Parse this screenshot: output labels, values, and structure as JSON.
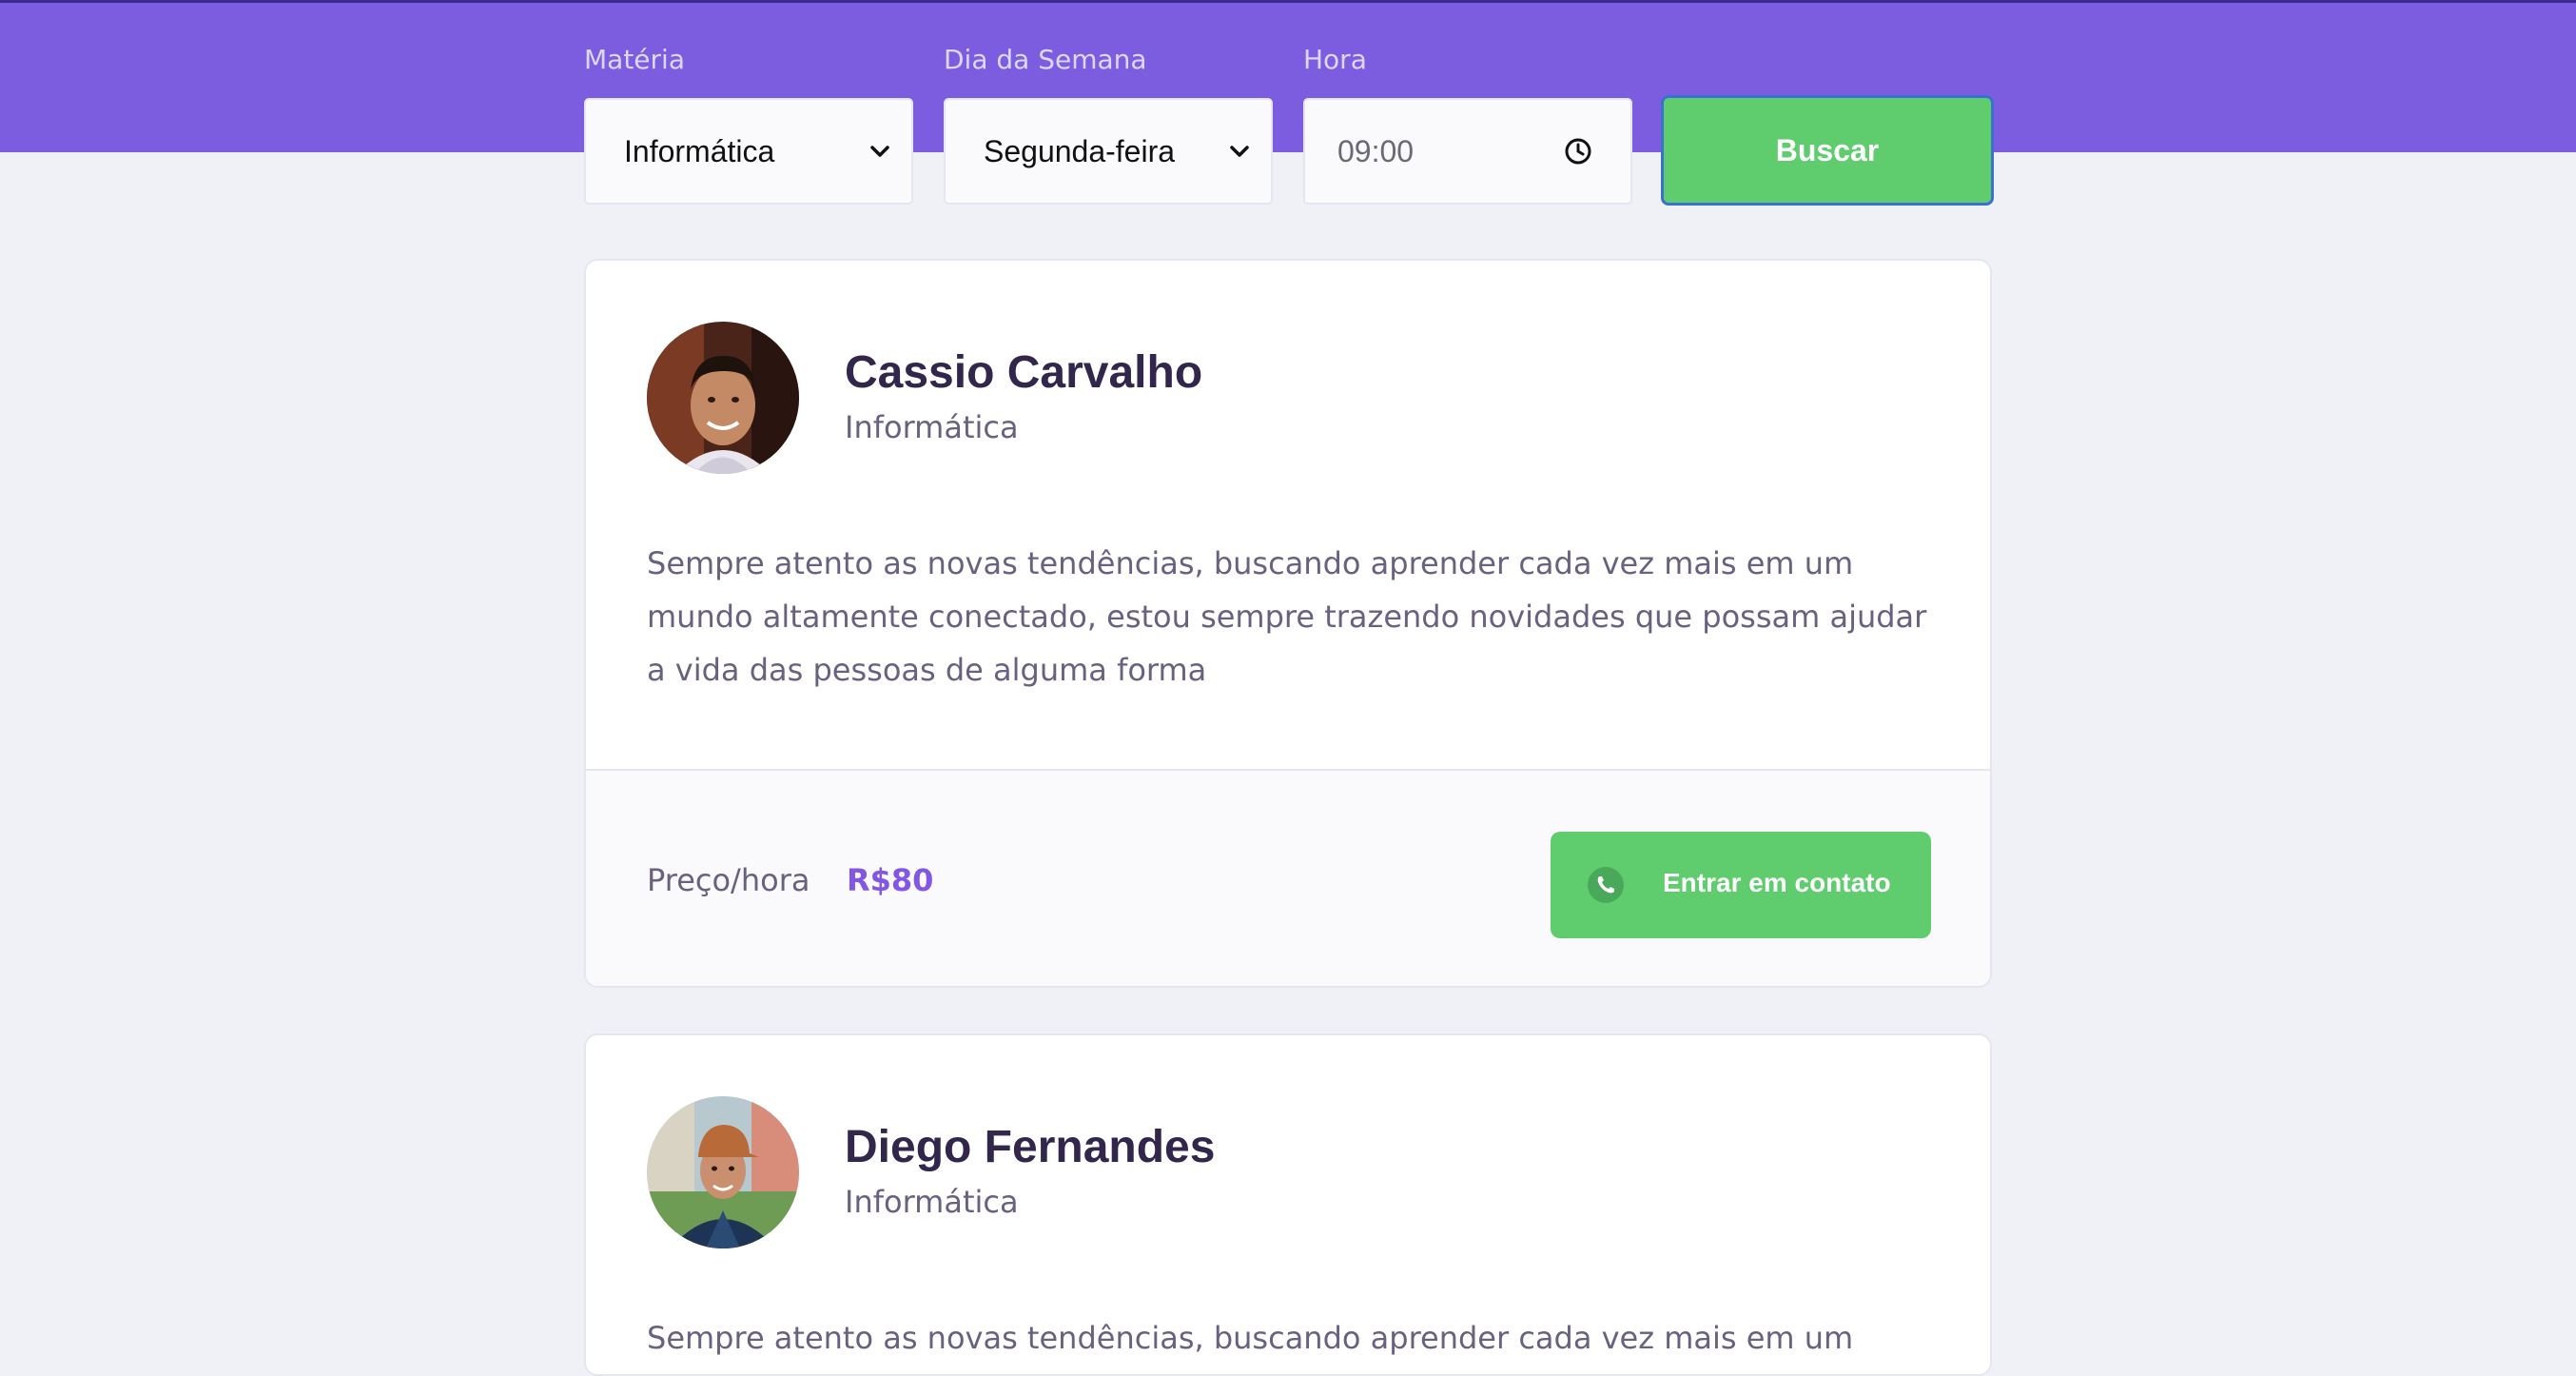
{
  "filters": {
    "subject": {
      "label": "Matéria",
      "value": "Informática"
    },
    "weekday": {
      "label": "Dia da Semana",
      "value": "Segunda-feira"
    },
    "time": {
      "label": "Hora",
      "value": "09:00"
    },
    "search_label": "Buscar"
  },
  "teachers": [
    {
      "name": "Cassio Carvalho",
      "subject": "Informática",
      "bio": "Sempre atento as novas tendências, buscando aprender cada vez mais em um mundo altamente conectado, estou sempre trazendo novidades que possam ajudar a vida das pessoas de alguma forma",
      "price_label": "Preço/hora",
      "price": "R$80",
      "contact_label": "Entrar em contato"
    },
    {
      "name": "Diego Fernandes",
      "subject": "Informática",
      "bio": "Sempre atento as novas tendências, buscando aprender cada vez mais em um"
    }
  ],
  "icons": {
    "select_arrow": "chevron-down-icon",
    "time": "clock-icon",
    "contact": "whatsapp-icon"
  },
  "colors": {
    "header": "#7c5de0",
    "accent_green": "#5fcd6e",
    "price": "#8257e5",
    "title": "#32264d",
    "text": "#6a6180"
  }
}
